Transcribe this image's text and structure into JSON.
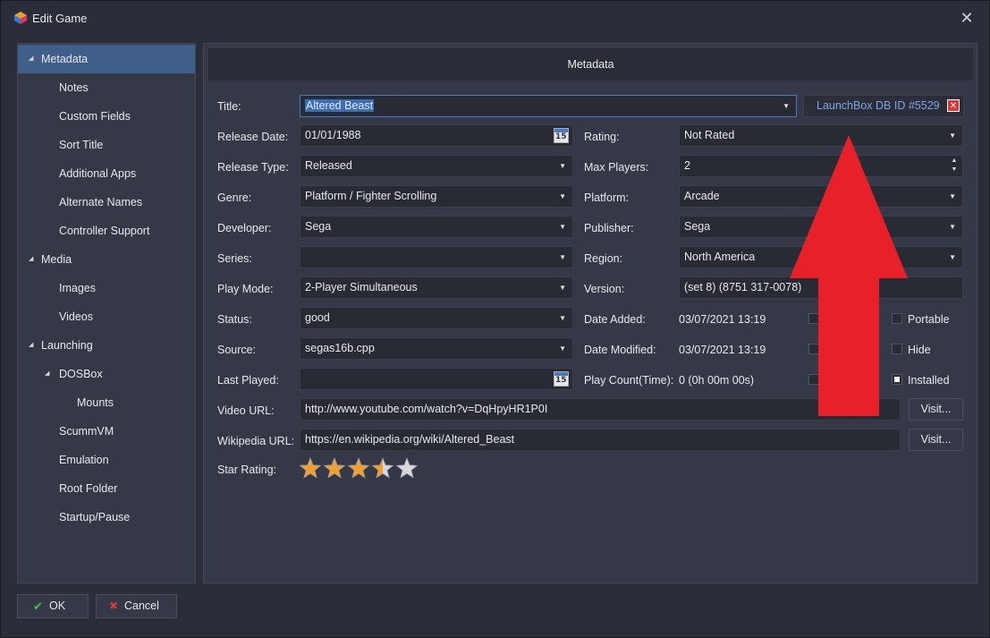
{
  "window": {
    "title": "Edit Game",
    "close": "✕"
  },
  "sidebar": {
    "items": [
      {
        "label": "Metadata",
        "arrow": "◢"
      },
      {
        "label": "Notes"
      },
      {
        "label": "Custom Fields"
      },
      {
        "label": "Sort Title"
      },
      {
        "label": "Additional Apps"
      },
      {
        "label": "Alternate Names"
      },
      {
        "label": "Controller Support"
      },
      {
        "label": "Media",
        "arrow": "◢"
      },
      {
        "label": "Images"
      },
      {
        "label": "Videos"
      },
      {
        "label": "Launching",
        "arrow": "◢"
      },
      {
        "label": "DOSBox",
        "arrow": "◢"
      },
      {
        "label": "Mounts"
      },
      {
        "label": "ScummVM"
      },
      {
        "label": "Emulation"
      },
      {
        "label": "Root Folder"
      },
      {
        "label": "Startup/Pause"
      }
    ]
  },
  "main": {
    "header": "Metadata",
    "title_label": "Title:",
    "title_value": "Altered Beast",
    "db_id": "LaunchBox DB ID #5529",
    "release_date_label": "Release Date:",
    "release_date": "01/01/1988",
    "calendar_day": "15",
    "rating_label": "Rating:",
    "rating": "Not Rated",
    "release_type_label": "Release Type:",
    "release_type": "Released",
    "max_players_label": "Max Players:",
    "max_players": "2",
    "genre_label": "Genre:",
    "genre": "Platform / Fighter Scrolling",
    "platform_label": "Platform:",
    "platform": "Arcade",
    "developer_label": "Developer:",
    "developer": "Sega",
    "publisher_label": "Publisher:",
    "publisher": "Sega",
    "series_label": "Series:",
    "series": "",
    "region_label": "Region:",
    "region": "North America",
    "play_mode_label": "Play Mode:",
    "play_mode": "2-Player Simultaneous",
    "version_label": "Version:",
    "version": "(set 8) (8751 317-0078)",
    "status_label": "Status:",
    "status": "good",
    "date_added_label": "Date Added:",
    "date_added": "03/07/2021 13:19",
    "portable_label": "Portable",
    "source_label": "Source:",
    "source": "segas16b.cpp",
    "date_modified_label": "Date Modified:",
    "date_modified": "03/07/2021 13:19",
    "hide_label": "Hide",
    "last_played_label": "Last Played:",
    "last_played": "",
    "play_count_label": "Play Count(Time):",
    "play_count": "0 (0h 00m 00s)",
    "installed_label": "Installed",
    "installed": true,
    "video_url_label": "Video URL:",
    "video_url": "http://www.youtube.com/watch?v=DqHpyHR1P0I",
    "wikipedia_url_label": "Wikipedia URL:",
    "wikipedia_url": "https://en.wikipedia.org/wiki/Altered_Beast",
    "visit_label": "Visit...",
    "star_rating_label": "Star Rating:",
    "star_rating": 3.5,
    "star_max": 5
  },
  "footer": {
    "ok": "OK",
    "cancel": "Cancel"
  },
  "colors": {
    "accent": "#3f5f8a",
    "arrow": "#e8202a",
    "star": "#f0a030"
  }
}
